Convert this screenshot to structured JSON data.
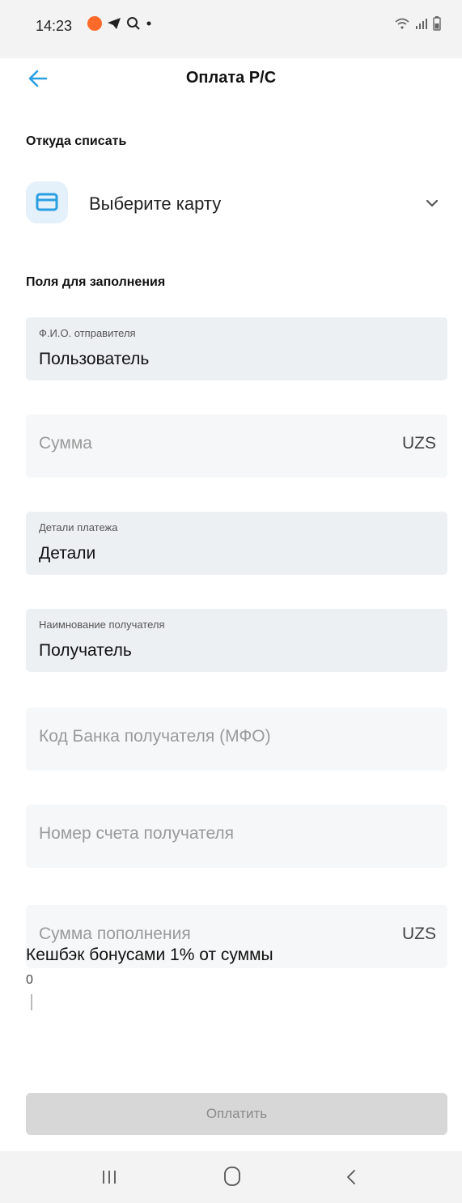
{
  "status_bar": {
    "time": "14:23"
  },
  "header": {
    "title": "Оплата Р/С"
  },
  "source": {
    "section_title": "Откуда списать",
    "card_placeholder": "Выберите карту"
  },
  "fields_section": {
    "title": "Поля для заполнения",
    "sender_name": {
      "label": "Ф.И.О. отправителя",
      "value": "Пользователь"
    },
    "amount": {
      "placeholder": "Сумма",
      "currency": "UZS"
    },
    "payment_details": {
      "label": "Детали платежа",
      "value": "Детали"
    },
    "recipient_name": {
      "label": "Наимнование получателя",
      "value": "Получатель"
    },
    "bank_code": {
      "placeholder": "Код Банка получателя (МФО)"
    },
    "account_number": {
      "placeholder": "Номер счета получателя"
    },
    "topup_amount": {
      "placeholder": "Сумма пополнения",
      "currency": "UZS"
    }
  },
  "cashback": {
    "label": "Кешбэк бонусами 1% от суммы",
    "value": "0"
  },
  "pay_button": {
    "label": "Оплатить"
  },
  "colors": {
    "accent": "#2a9fe0",
    "field_bg": "#f6f7f8",
    "field_filled_bg": "#edf0f3",
    "button_disabled": "#d7d7d7"
  },
  "icons": {
    "back": "arrow-left-icon",
    "card": "credit-card-icon",
    "dropdown": "chevron-down-icon"
  }
}
